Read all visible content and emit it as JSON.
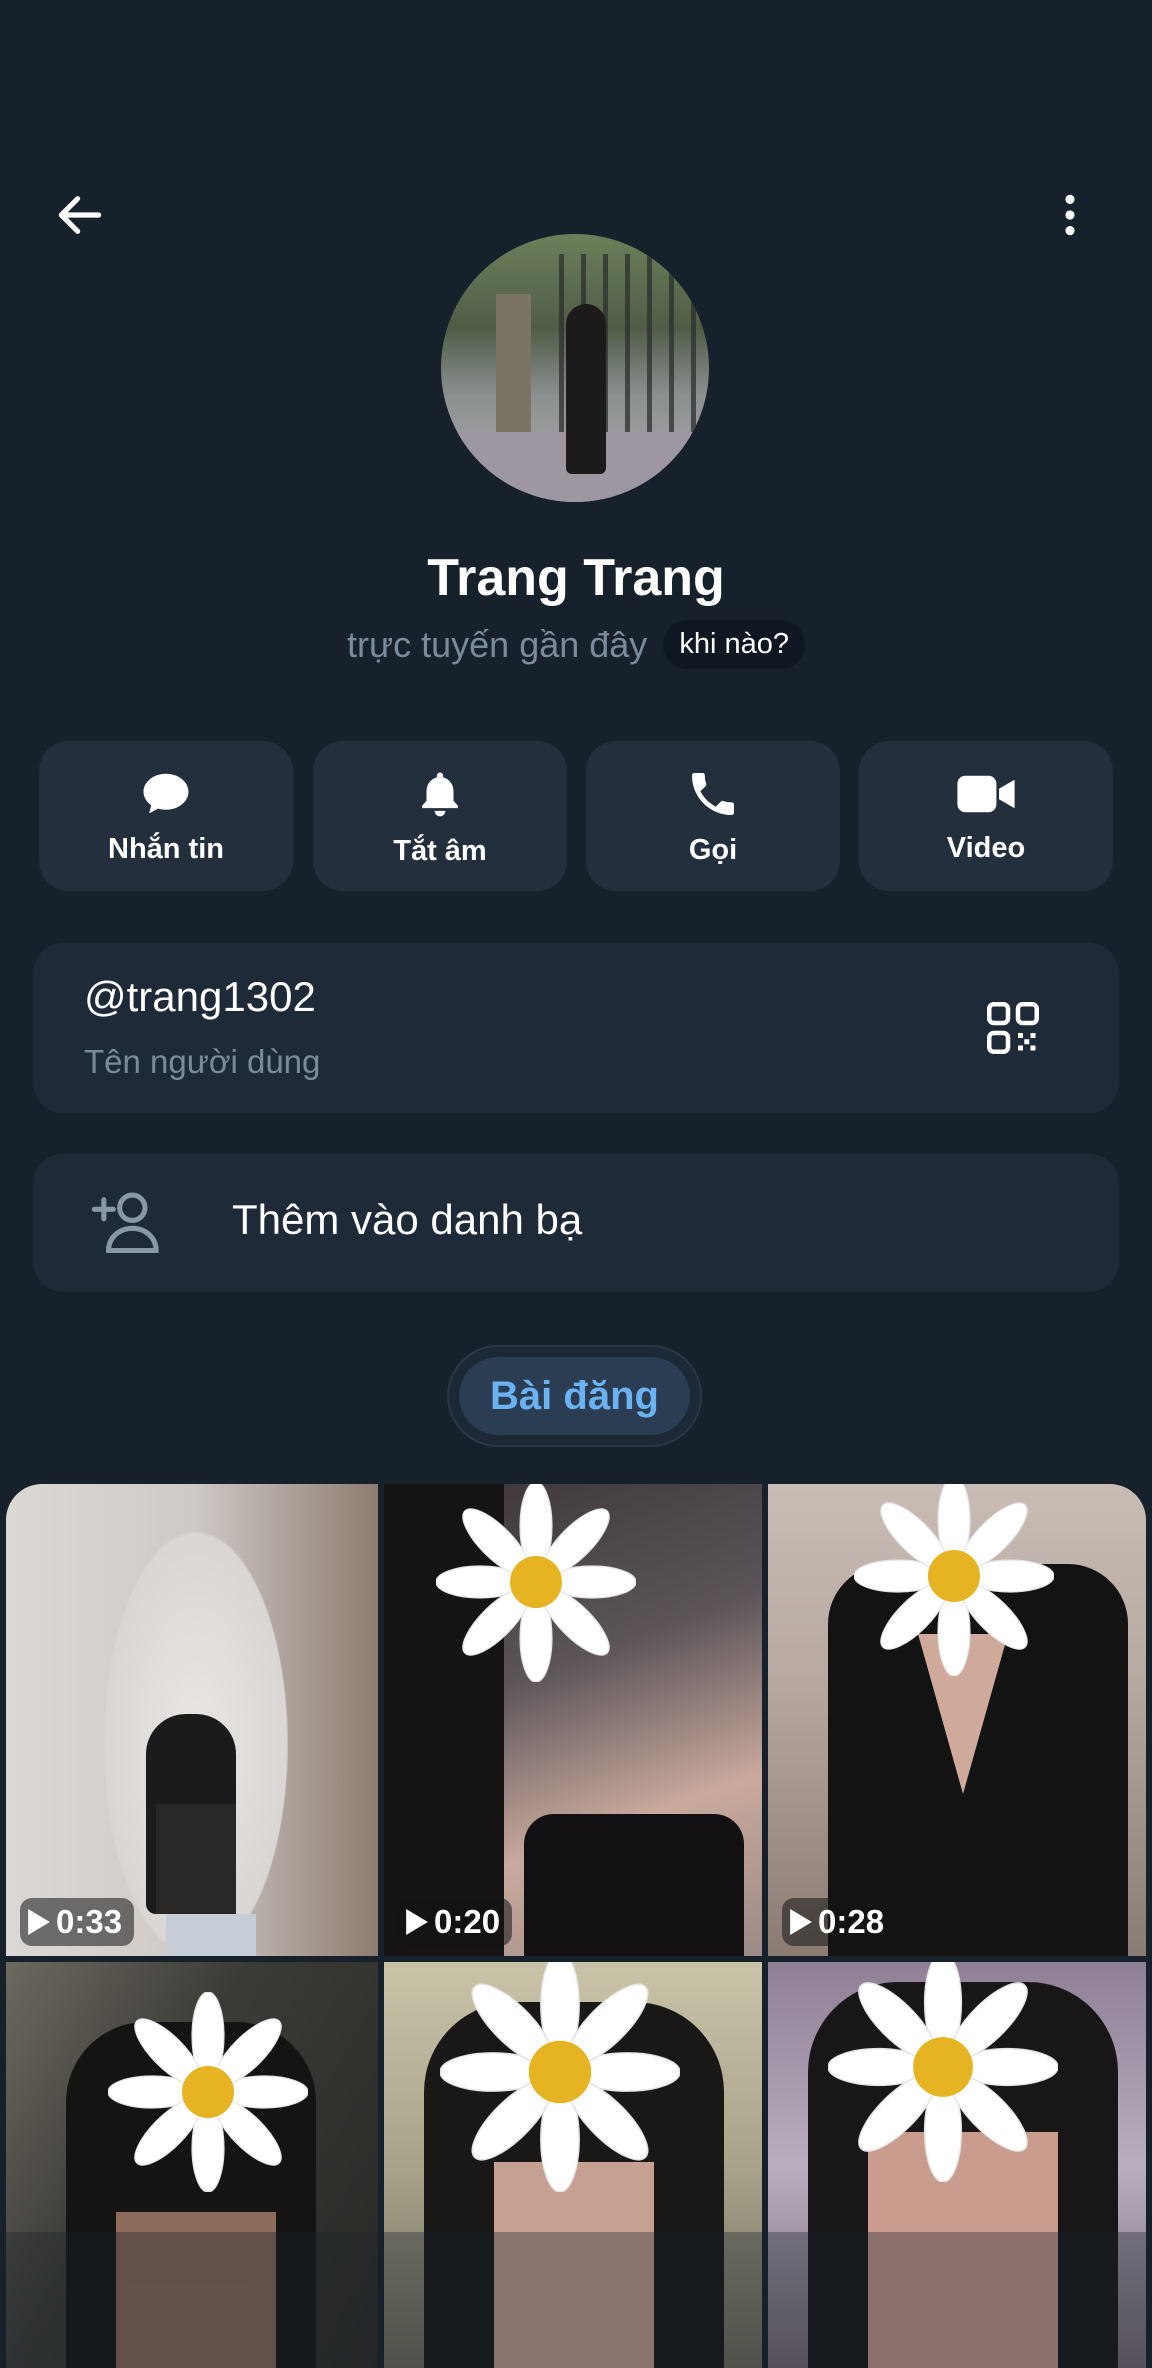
{
  "profile": {
    "name": "Trang Trang",
    "status": "trực tuyến gần đây",
    "status_hint": "khi nào?"
  },
  "actions": [
    {
      "label": "Nhắn tin",
      "icon": "message-icon"
    },
    {
      "label": "Tắt âm",
      "icon": "bell-icon"
    },
    {
      "label": "Gọi",
      "icon": "phone-icon"
    },
    {
      "label": "Video",
      "icon": "video-camera-icon"
    }
  ],
  "username": {
    "value": "@trang1302",
    "caption": "Tên người dùng"
  },
  "add_contact": {
    "label": "Thêm vào danh bạ"
  },
  "tabs": {
    "posts": "Bài đăng"
  },
  "media": [
    {
      "duration": "0:33"
    },
    {
      "duration": "0:20"
    },
    {
      "duration": "0:28"
    },
    {
      "duration": ""
    },
    {
      "duration": ""
    },
    {
      "duration": ""
    }
  ],
  "colors": {
    "background": "#17212b",
    "card": "#1f2a38",
    "accent": "#6ab2f2",
    "muted_text": "#7c8b99"
  }
}
